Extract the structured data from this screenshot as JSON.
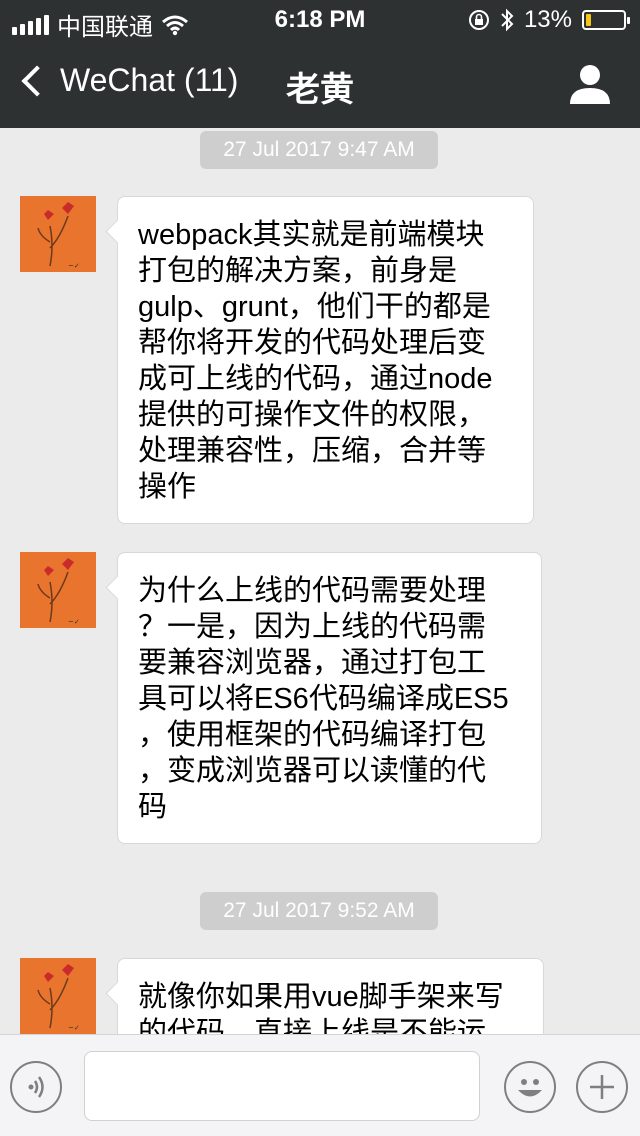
{
  "status": {
    "carrier": "中国联通",
    "time": "6:18 PM",
    "battery": "13%",
    "battery_level": 0.13
  },
  "nav": {
    "back_label": "WeChat (11)",
    "title": "老黄"
  },
  "messages": [
    {
      "timestamp": "27 Jul 2017 9:47 AM",
      "lines": [
        "webpack其实就是前端模块",
        "打包的解决方案，前身是",
        "gulp、grunt，他们干的都是",
        "帮你将开发的代码处理后变",
        "成可上线的代码，通过node",
        "提供的可操作文件的权限，",
        "处理兼容性，压缩，合并等",
        "操作"
      ]
    },
    {
      "lines": [
        "为什么上线的代码需要处理",
        "？一是，因为上线的代码需",
        "要兼容浏览器，通过打包工",
        "具可以将ES6代码编译成ES5",
        "，使用框架的代码编译打包",
        "，变成浏览器可以读懂的代",
        "码"
      ]
    },
    {
      "timestamp": "27 Jul 2017 9:52 AM",
      "lines": [
        "就像你如果用vue脚手架来写",
        "的代码，直接上线是不能运"
      ]
    }
  ],
  "icons": {
    "wifi": "wifi-icon",
    "lock": "orientation-lock-icon",
    "bluetooth": "bluetooth-icon",
    "back": "chevron-left-icon",
    "profile": "person-icon",
    "voice": "voice-icon",
    "emoji": "emoji-icon",
    "add": "plus-icon"
  }
}
